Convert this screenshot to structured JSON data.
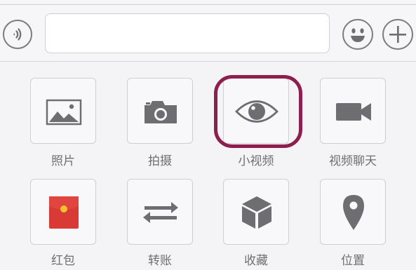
{
  "input_bar": {
    "text_value": ""
  },
  "panel": {
    "items": [
      {
        "label": "照片",
        "icon": "photo-icon"
      },
      {
        "label": "拍摄",
        "icon": "camera-icon"
      },
      {
        "label": "小视频",
        "icon": "eye-icon"
      },
      {
        "label": "视频聊天",
        "icon": "video-camera-icon"
      },
      {
        "label": "红包",
        "icon": "red-packet-icon"
      },
      {
        "label": "转账",
        "icon": "transfer-arrows-icon"
      },
      {
        "label": "收藏",
        "icon": "cube-icon"
      },
      {
        "label": "位置",
        "icon": "location-pin-icon"
      }
    ]
  },
  "colors": {
    "icon_gray": "#6e6e72",
    "highlight_ring": "#8e1e4e",
    "red_packet": "#d93a36",
    "red_packet_coin": "#f5c02a"
  }
}
